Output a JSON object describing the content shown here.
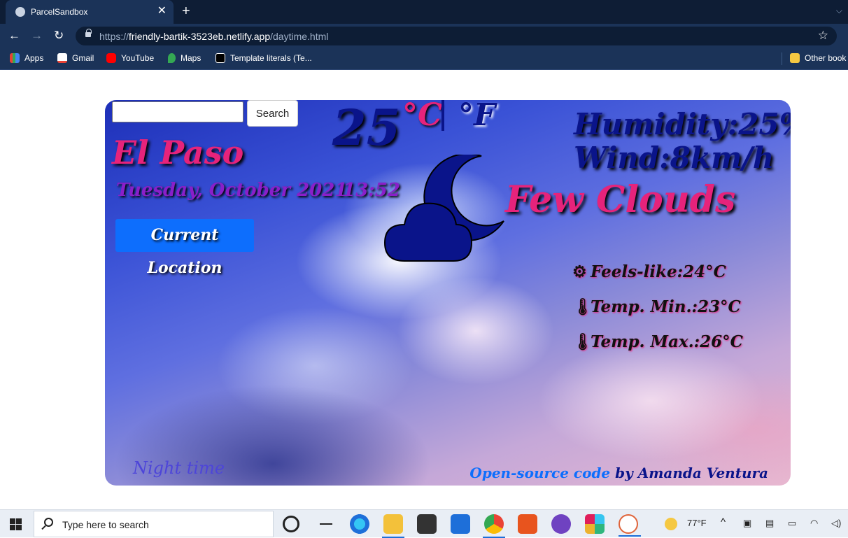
{
  "browser": {
    "tab_title": "ParcelSandbox",
    "url_prefix": "https://",
    "url_host": "friendly-bartik-3523eb.netlify.app",
    "url_path": "/daytime.html",
    "bookmarks": [
      "Apps",
      "Gmail",
      "YouTube",
      "Maps",
      "Template literals (Te...",
      "Other book"
    ]
  },
  "weather": {
    "search_button": "Search",
    "search_value": "",
    "temperature": "25",
    "unit_celsius": "°C",
    "unit_fahrenheit": "°F",
    "city": "El Paso",
    "date": "Tuesday, October 2021",
    "time": "13:52",
    "current_location_button": "Current Location",
    "humidity": "Humidity:25%",
    "wind": "Wind:8km/h",
    "condition": "Few Clouds",
    "condition_icon": "moon-cloud-icon",
    "feels_like": "Feels-like:24°C",
    "temp_min": "Temp. Min.:23°C",
    "temp_max": "Temp. Max.:26°C",
    "mode_label": "Night time",
    "credit_link": "Open-source code",
    "credit_author": " by Amanda Ventura",
    "colors": {
      "pink": "#e6237b",
      "navy": "#0a148a",
      "purple": "#8a1fc9",
      "button_blue": "#0d6efd"
    }
  },
  "taskbar": {
    "search_placeholder": "Type here to search",
    "weather_temp": "77°F"
  }
}
